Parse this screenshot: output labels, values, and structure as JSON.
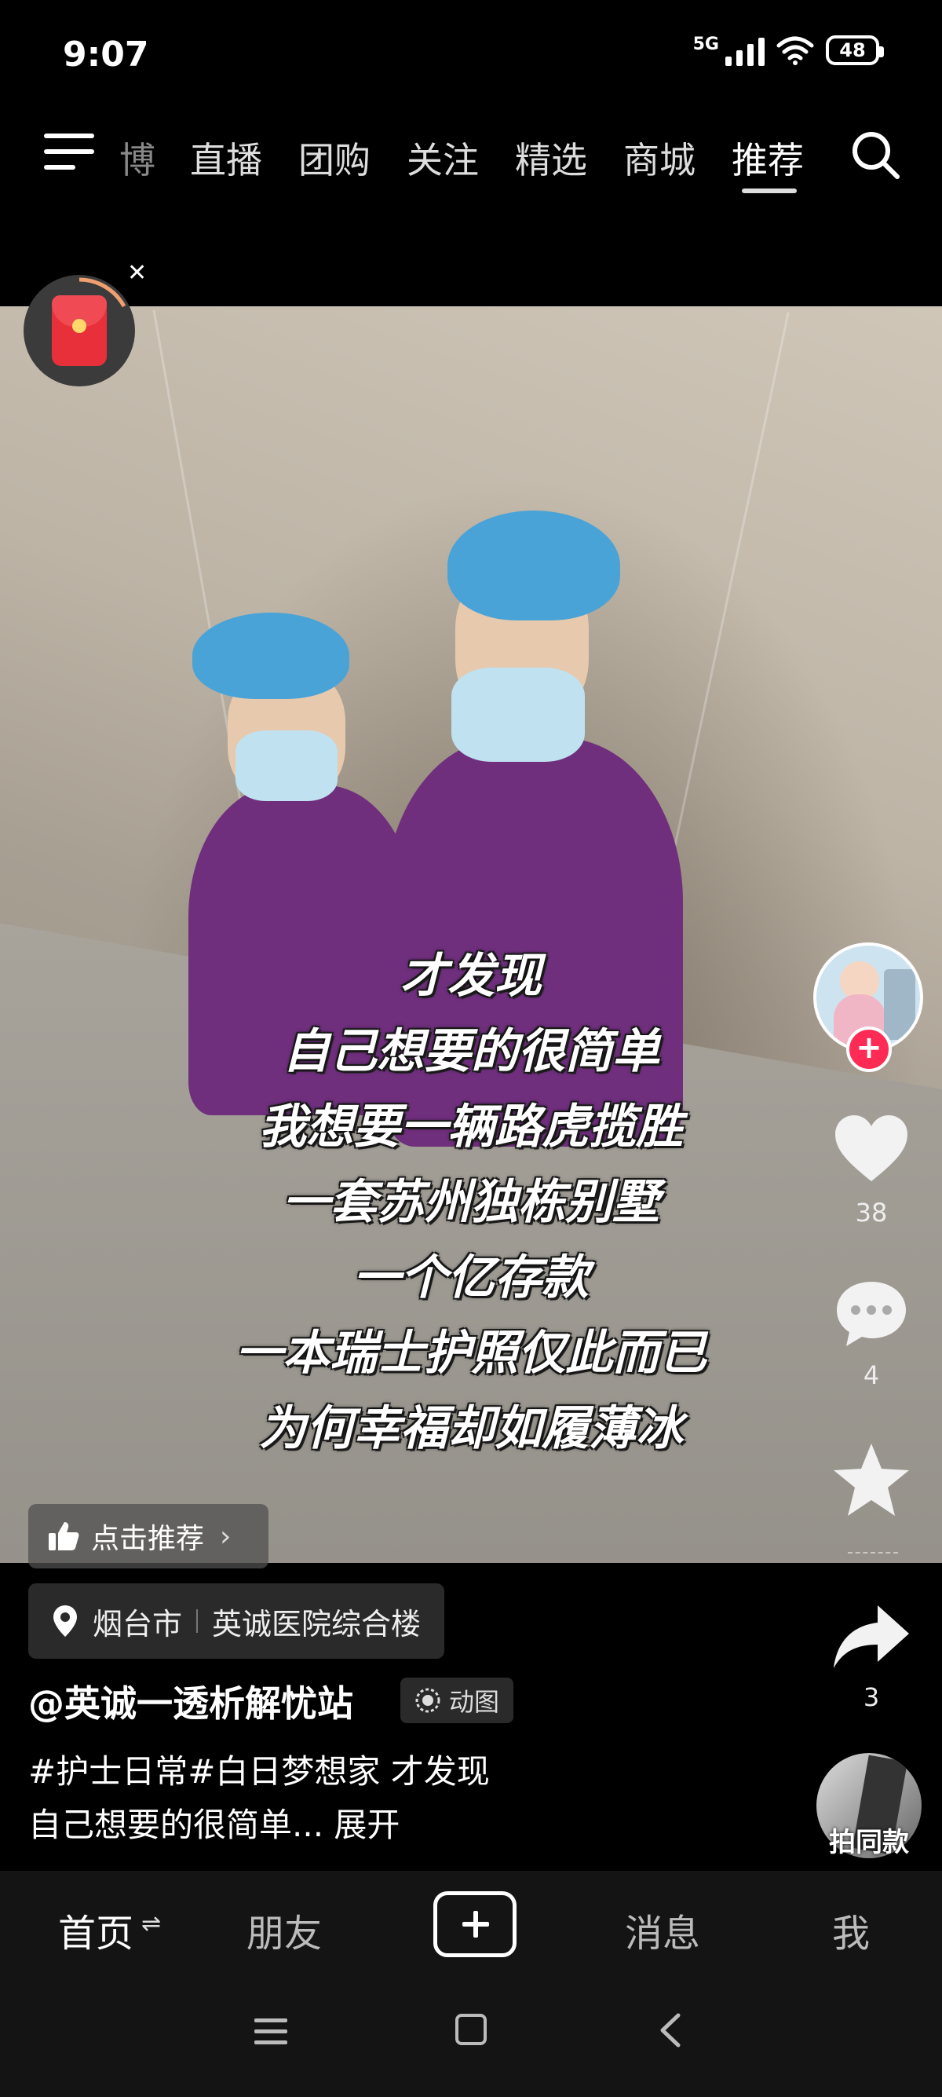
{
  "status_bar": {
    "time": "9:07",
    "network": "5G",
    "battery": "48"
  },
  "top_tabs": [
    {
      "label": "博",
      "active": false
    },
    {
      "label": "直播",
      "active": false
    },
    {
      "label": "团购",
      "active": false
    },
    {
      "label": "关注",
      "active": false
    },
    {
      "label": "精选",
      "active": false
    },
    {
      "label": "商城",
      "active": false
    },
    {
      "label": "推荐",
      "active": true
    }
  ],
  "caption_lines": [
    "才发现",
    "自己想要的很简单",
    "我想要一辆路虎揽胜",
    "一套苏州独栋别墅",
    "一个亿存款",
    "一本瑞士护照仅此而已",
    "为何幸福却如履薄冰"
  ],
  "actions": {
    "likes": "38",
    "comments": "4",
    "shares": "3"
  },
  "recommend_chip": {
    "label": "点击推荐"
  },
  "location": {
    "city": "烟台市",
    "place": "英诚医院综合楼"
  },
  "author": {
    "handle": "@英诚一透析解忧站",
    "badge": "动图"
  },
  "description": {
    "line1": "#护士日常#白日梦想家 才发现",
    "line2": "自己想要的很简单... 展开"
  },
  "same_style": {
    "label": "拍同款"
  },
  "bottom_nav": [
    {
      "label": "首页",
      "active": true
    },
    {
      "label": "朋友",
      "active": false
    },
    {
      "label": "消息",
      "active": false
    },
    {
      "label": "我",
      "active": false
    }
  ],
  "colors": {
    "follow": "#fe2c55",
    "scrub": "#6f2f7d",
    "cap": "#4aa3d6",
    "background": "#000000"
  }
}
